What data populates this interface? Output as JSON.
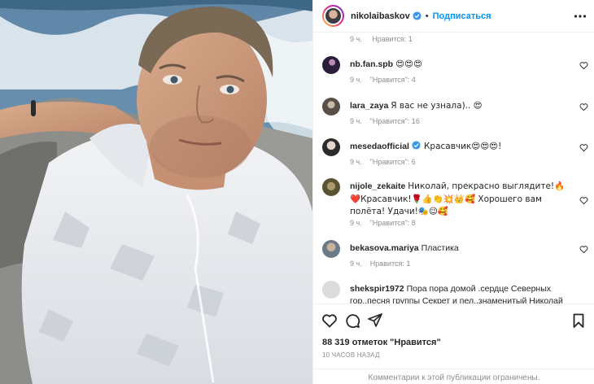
{
  "post": {
    "author": "nikolaibaskov",
    "separator": "•",
    "follow_label": "Подписаться",
    "top_meta": {
      "time": "9 ч.",
      "likes": "Нравится: 1"
    },
    "likes_count": "88 319 отметок \"Нравится\"",
    "posted_time": "10 ЧАСОВ НАЗАД",
    "comments_limited": "Комментарии к этой публикации ограничены."
  },
  "comments": [
    {
      "user": "nb.fan.spb",
      "text": "😍😍😍",
      "time": "9 ч.",
      "likes": "\"Нравится\": 4"
    },
    {
      "user": "lara_zaya",
      "text": "Я вас не узнала).. 😍",
      "time": "9 ч.",
      "likes": "\"Нравится\": 16"
    },
    {
      "user": "mesedaofficial",
      "text": "Красавчик😍😍😍!",
      "time": "9 ч.",
      "likes": "\"Нравится\": 6"
    },
    {
      "user": "nijole_zekaite",
      "text": "Николай, прекрасно выглядите!🔥❤️Красавчик!🌹👍👏💥👑🥰 Хорошего вам полёта! Удачи!🎭😉🥰",
      "time": "9 ч.",
      "likes": "\"Нравится\": 8"
    },
    {
      "user": "bekasova.mariya",
      "text": "Пластика",
      "time": "9 ч.",
      "likes": "Нравится: 1"
    },
    {
      "user": "shekspir1972",
      "text": "Пора пора домой .сердце Северных гор..песня группы Секрет и пел..знаменитый Николай Фоменко и как",
      "time": "",
      "likes": ""
    }
  ],
  "icons": {
    "verified": "verified-badge-icon",
    "more": "more-options-icon",
    "like": "heart-outline-icon",
    "comment": "comment-bubble-icon",
    "share": "paper-plane-icon",
    "save": "bookmark-icon"
  },
  "colors": {
    "link": "#0095f6",
    "muted": "#8e8e8e",
    "text": "#262626"
  }
}
